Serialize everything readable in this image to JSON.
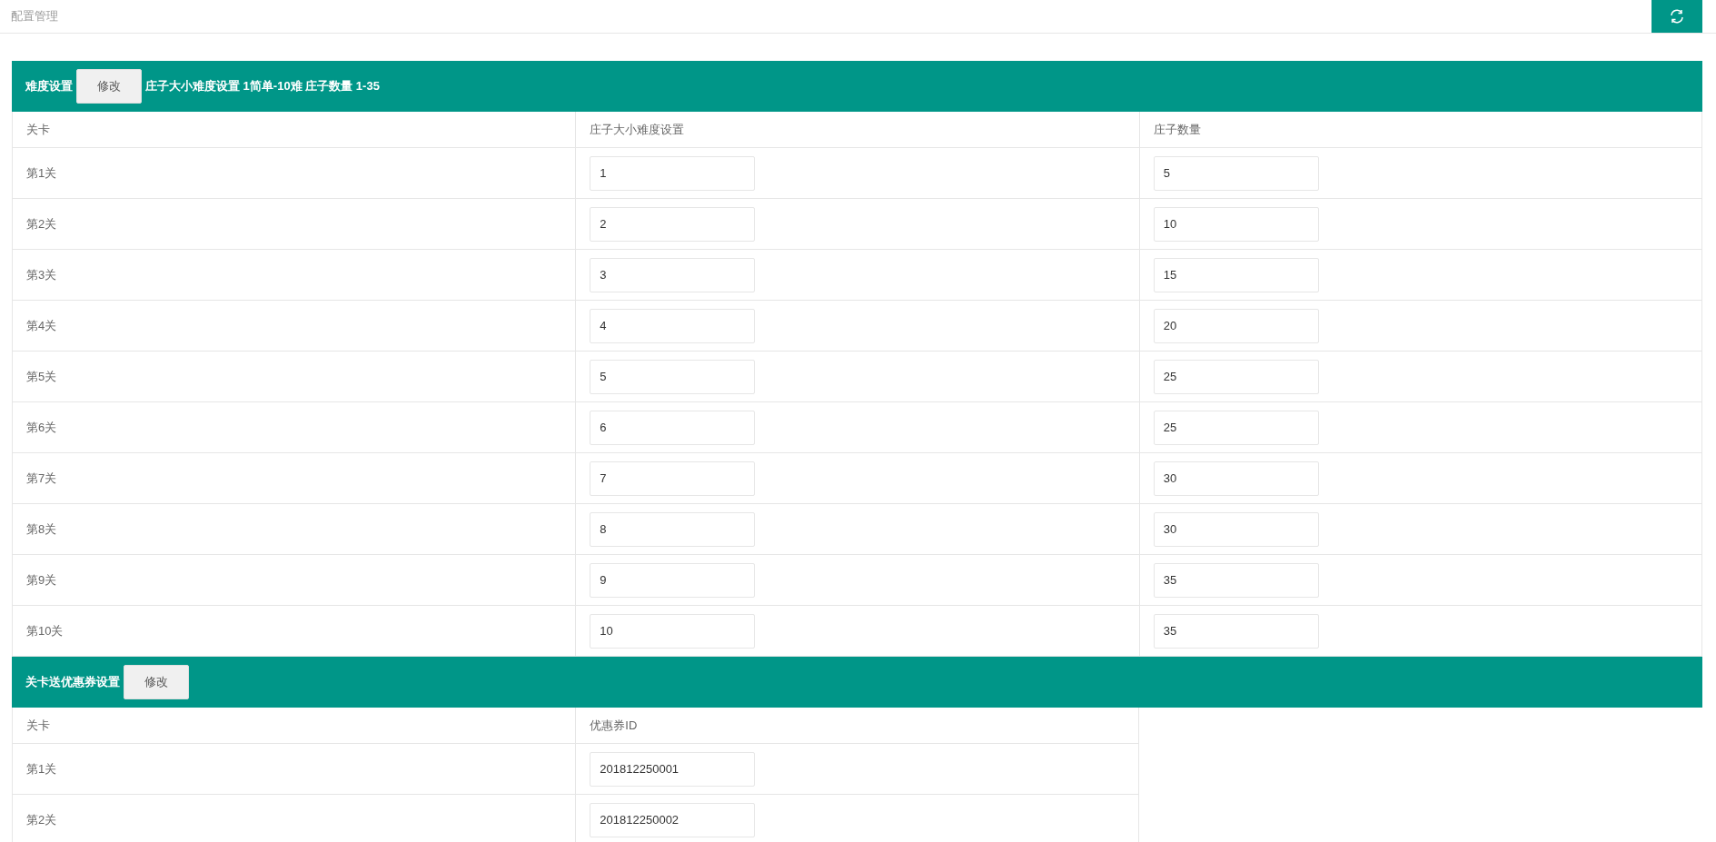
{
  "page_title": "配置管理",
  "sections": [
    {
      "title": "难度设置",
      "button": "修改",
      "note": "庄子大小难度设置 1简单-10难 庄子数量 1-35",
      "columns": [
        "关卡",
        "庄子大小难度设置",
        "庄子数量"
      ],
      "rows": [
        {
          "stage": "第1关",
          "fields": [
            "1",
            "5"
          ]
        },
        {
          "stage": "第2关",
          "fields": [
            "2",
            "10"
          ]
        },
        {
          "stage": "第3关",
          "fields": [
            "3",
            "15"
          ]
        },
        {
          "stage": "第4关",
          "fields": [
            "4",
            "20"
          ]
        },
        {
          "stage": "第5关",
          "fields": [
            "5",
            "25"
          ]
        },
        {
          "stage": "第6关",
          "fields": [
            "6",
            "25"
          ]
        },
        {
          "stage": "第7关",
          "fields": [
            "7",
            "30"
          ]
        },
        {
          "stage": "第8关",
          "fields": [
            "8",
            "30"
          ]
        },
        {
          "stage": "第9关",
          "fields": [
            "9",
            "35"
          ]
        },
        {
          "stage": "第10关",
          "fields": [
            "10",
            "35"
          ]
        }
      ]
    },
    {
      "title": "关卡送优惠券设置",
      "button": "修改",
      "columns": [
        "关卡",
        "优惠券ID"
      ],
      "rows": [
        {
          "stage": "第1关",
          "fields": [
            "201812250001"
          ]
        },
        {
          "stage": "第2关",
          "fields": [
            "201812250002"
          ]
        }
      ]
    }
  ]
}
